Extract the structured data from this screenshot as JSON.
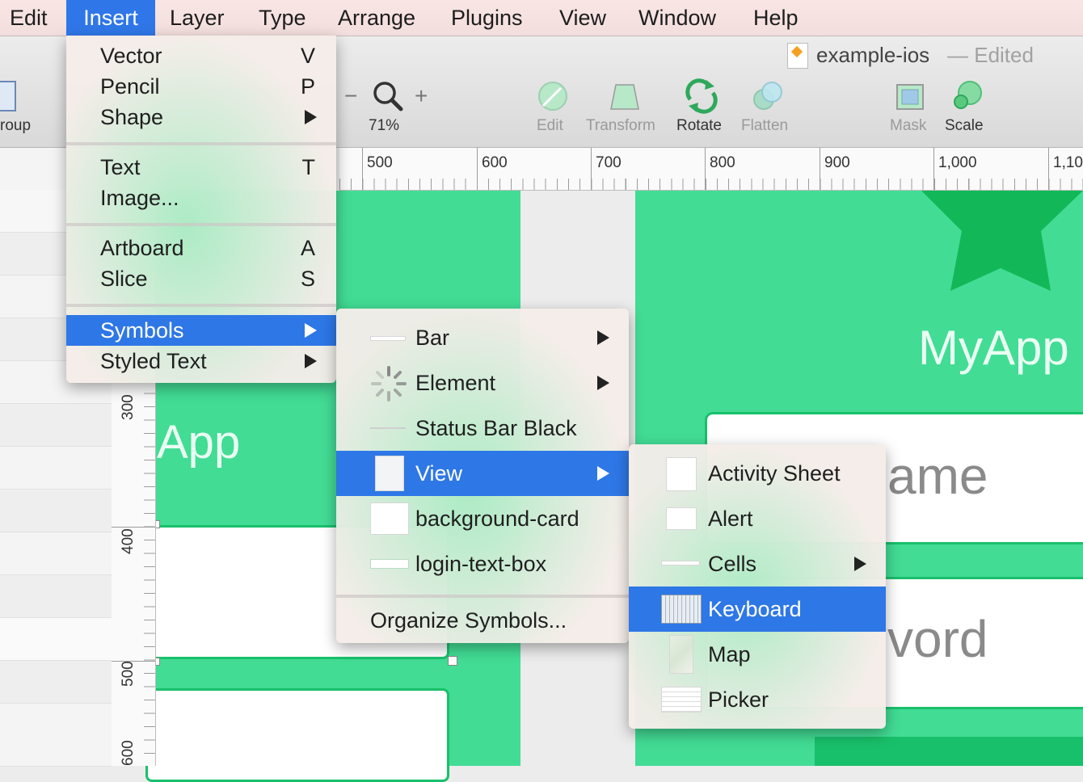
{
  "menubar": {
    "items": [
      "Edit",
      "Insert",
      "Layer",
      "Type",
      "Arrange",
      "Plugins",
      "View",
      "Window",
      "Help"
    ],
    "active": "Insert"
  },
  "window": {
    "title": "example-ios",
    "status": "— Edited"
  },
  "toolbar": {
    "group_label": "roup",
    "zoom": "71%",
    "zoom_minus": "−",
    "zoom_plus": "+",
    "buttons": [
      "Edit",
      "Transform",
      "Rotate",
      "Flatten",
      "Mask",
      "Scale"
    ]
  },
  "ruler": {
    "h_labels": [
      "500",
      "600",
      "700",
      "800",
      "900",
      "1,000",
      "1,10"
    ],
    "v_labels": [
      "300",
      "400",
      "500",
      "600"
    ]
  },
  "canvas": {
    "app_title_right": "MyApp",
    "app_title_left": "App",
    "field_name_fragment": "ame",
    "field_password_fragment": "vord"
  },
  "insert_menu": {
    "items": [
      {
        "label": "Vector",
        "shortcut": "V"
      },
      {
        "label": "Pencil",
        "shortcut": "P"
      },
      {
        "label": "Shape",
        "submenu": true
      },
      {
        "label": "Text",
        "shortcut": "T"
      },
      {
        "label": "Image..."
      },
      {
        "label": "Artboard",
        "shortcut": "A"
      },
      {
        "label": "Slice",
        "shortcut": "S"
      },
      {
        "label": "Symbols",
        "submenu": true,
        "highlighted": true
      },
      {
        "label": "Styled Text",
        "submenu": true
      }
    ]
  },
  "symbols_menu": {
    "items": [
      {
        "label": "Bar",
        "submenu": true,
        "icon": "bar-thumbnail-icon"
      },
      {
        "label": "Element",
        "submenu": true,
        "icon": "spinner-icon"
      },
      {
        "label": "Status Bar Black",
        "icon": "status-bar-thumbnail-icon"
      },
      {
        "label": "View",
        "submenu": true,
        "highlighted": true,
        "icon": "view-thumbnail-icon"
      },
      {
        "label": "background-card",
        "icon": "card-thumbnail-icon"
      },
      {
        "label": "login-text-box",
        "icon": "textbox-thumbnail-icon"
      },
      {
        "label": "Organize Symbols..."
      }
    ]
  },
  "view_menu": {
    "items": [
      {
        "label": "Activity Sheet",
        "icon": "activity-sheet-thumbnail-icon"
      },
      {
        "label": "Alert",
        "icon": "alert-thumbnail-icon"
      },
      {
        "label": "Cells",
        "submenu": true,
        "icon": "cells-thumbnail-icon"
      },
      {
        "label": "Keyboard",
        "highlighted": true,
        "icon": "keyboard-thumbnail-icon"
      },
      {
        "label": "Map",
        "icon": "map-thumbnail-icon"
      },
      {
        "label": "Picker",
        "icon": "picker-thumbnail-icon"
      }
    ]
  },
  "colors": {
    "accent": "#2f77e8",
    "artboard_green": "#42dc95",
    "star_green": "#12b858"
  }
}
